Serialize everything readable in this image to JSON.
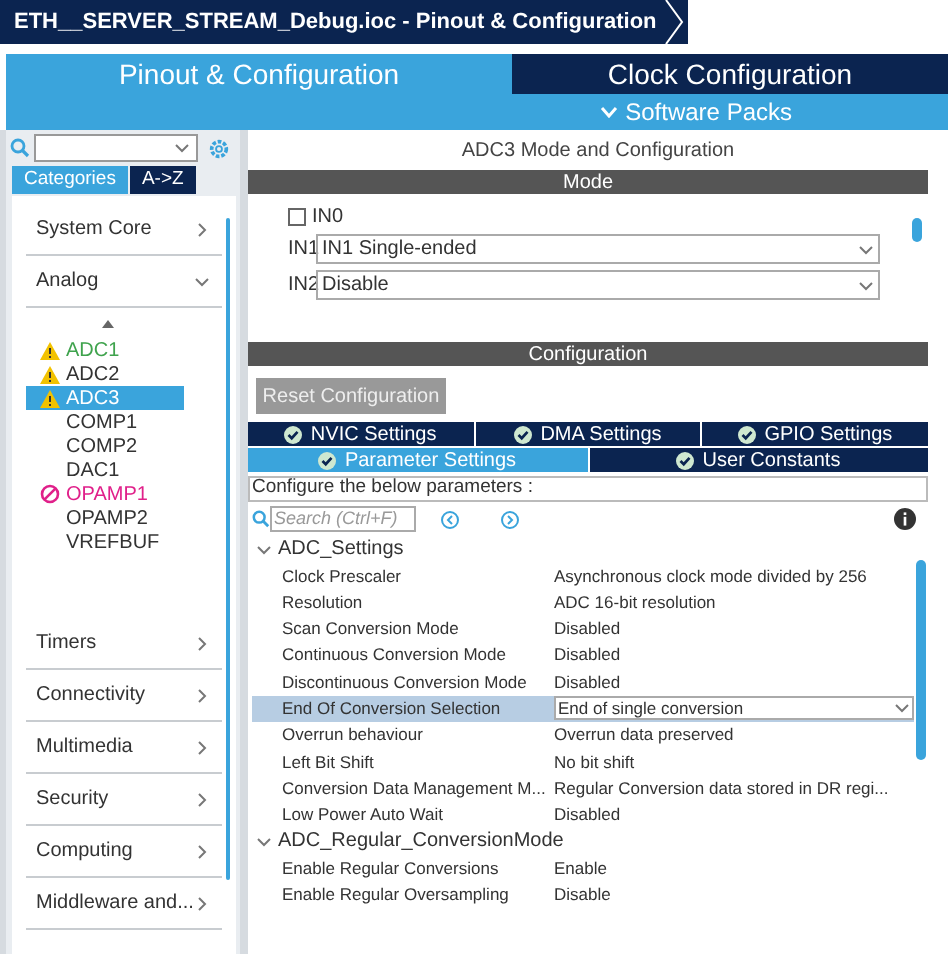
{
  "title": "ETH__SERVER_STREAM_Debug.ioc - Pinout & Configuration",
  "main_tabs": [
    {
      "label": "Pinout & Configuration",
      "selected": true
    },
    {
      "label": "Clock Configuration",
      "selected": false
    }
  ],
  "software_packs": "Software Packs",
  "sidebar": {
    "view_tabs": [
      {
        "label": "Categories",
        "selected": true
      },
      {
        "label": "A->Z",
        "selected": false
      }
    ],
    "categories": [
      {
        "label": "System Core",
        "expanded": false
      },
      {
        "label": "Analog",
        "expanded": true,
        "children": [
          {
            "label": "ADC1",
            "kind": "configured-warning",
            "selected": false
          },
          {
            "label": "ADC2",
            "kind": "warning",
            "selected": false
          },
          {
            "label": "ADC3",
            "kind": "warning",
            "selected": true
          },
          {
            "label": "COMP1",
            "kind": "plain",
            "selected": false
          },
          {
            "label": "COMP2",
            "kind": "plain",
            "selected": false
          },
          {
            "label": "DAC1",
            "kind": "plain",
            "selected": false
          },
          {
            "label": "OPAMP1",
            "kind": "blocked",
            "selected": false
          },
          {
            "label": "OPAMP2",
            "kind": "plain",
            "selected": false
          },
          {
            "label": "VREFBUF",
            "kind": "plain",
            "selected": false
          }
        ]
      },
      {
        "label": "Timers",
        "expanded": false
      },
      {
        "label": "Connectivity",
        "expanded": false
      },
      {
        "label": "Multimedia",
        "expanded": false
      },
      {
        "label": "Security",
        "expanded": false
      },
      {
        "label": "Computing",
        "expanded": false
      },
      {
        "label": "Middleware and...",
        "expanded": false
      }
    ]
  },
  "panel": {
    "title": "ADC3 Mode and Configuration",
    "mode": {
      "heading": "Mode",
      "in0": {
        "label": "IN0",
        "checked": false
      },
      "channels": [
        {
          "label": "IN1",
          "value": "IN1 Single-ended"
        },
        {
          "label": "IN2",
          "value": "Disable"
        }
      ]
    },
    "configuration": {
      "heading": "Configuration",
      "reset_button": "Reset Configuration",
      "tab_rows": [
        [
          {
            "label": "NVIC Settings",
            "selected": false
          },
          {
            "label": "DMA Settings",
            "selected": false
          },
          {
            "label": "GPIO Settings",
            "selected": false
          }
        ],
        [
          {
            "label": "Parameter Settings",
            "selected": true
          },
          {
            "label": "User Constants",
            "selected": false
          }
        ]
      ],
      "description": "Configure the below parameters :",
      "search": {
        "placeholder": "Search (Ctrl+F)"
      },
      "groups": [
        {
          "label": "ADC_Settings",
          "expanded": true,
          "params": [
            {
              "name": "Clock Prescaler",
              "value": "Asynchronous clock mode divided by 256",
              "selected": false
            },
            {
              "name": "Resolution",
              "value": "ADC 16-bit resolution",
              "selected": false
            },
            {
              "name": "Scan Conversion Mode",
              "value": "Disabled",
              "selected": false
            },
            {
              "name": "Continuous Conversion Mode",
              "value": "Disabled",
              "selected": false
            },
            {
              "name": "Discontinuous Conversion Mode",
              "value": "Disabled",
              "selected": false
            },
            {
              "name": "End Of Conversion Selection",
              "value": "End of single conversion",
              "selected": true
            },
            {
              "name": "Overrun behaviour",
              "value": "Overrun data preserved",
              "selected": false
            },
            {
              "name": "Left Bit Shift",
              "value": "No bit shift",
              "selected": false
            },
            {
              "name": "Conversion Data Management M...",
              "value": "Regular Conversion data stored in DR regi...",
              "selected": false
            },
            {
              "name": "Low Power Auto Wait",
              "value": "Disabled",
              "selected": false
            }
          ]
        },
        {
          "label": "ADC_Regular_ConversionMode",
          "expanded": true,
          "params": [
            {
              "name": "Enable Regular Conversions",
              "value": "Enable",
              "selected": false
            },
            {
              "name": "Enable Regular Oversampling",
              "value": "Disable",
              "selected": false
            }
          ]
        }
      ]
    }
  }
}
